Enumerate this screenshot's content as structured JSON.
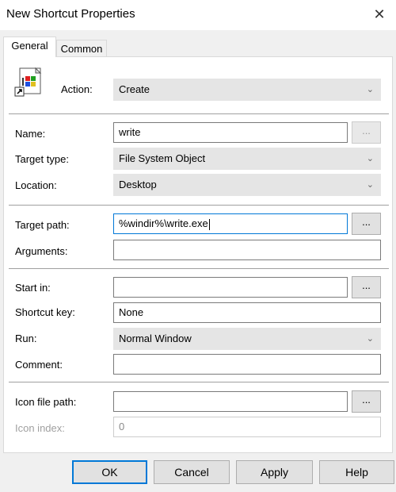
{
  "window": {
    "title": "New Shortcut Properties",
    "close_icon": "close-icon"
  },
  "tabs": [
    {
      "label": "General",
      "active": true
    },
    {
      "label": "Common",
      "active": false
    }
  ],
  "action": {
    "label": "Action:",
    "value": "Create",
    "icon": "shortcut-app-icon"
  },
  "name": {
    "label": "Name:",
    "value": "write",
    "browse": "..."
  },
  "target_type": {
    "label": "Target type:",
    "value": "File System Object"
  },
  "location": {
    "label": "Location:",
    "value": "Desktop"
  },
  "target_path": {
    "label": "Target path:",
    "value": "%windir%\\write.exe",
    "browse": "..."
  },
  "arguments": {
    "label": "Arguments:",
    "value": ""
  },
  "start_in": {
    "label": "Start in:",
    "value": "",
    "browse": "..."
  },
  "shortcut_key": {
    "label": "Shortcut key:",
    "value": "None"
  },
  "run": {
    "label": "Run:",
    "value": "Normal Window"
  },
  "comment": {
    "label": "Comment:",
    "value": ""
  },
  "icon_file_path": {
    "label": "Icon file path:",
    "value": "",
    "browse": "..."
  },
  "icon_index": {
    "label": "Icon index:",
    "value": "0"
  },
  "buttons": {
    "ok": "OK",
    "cancel": "Cancel",
    "apply": "Apply",
    "help": "Help"
  },
  "colors": {
    "focus": "#0078d7",
    "combo_bg": "#e5e5e5",
    "dialog_bg": "#f0f0f0"
  }
}
